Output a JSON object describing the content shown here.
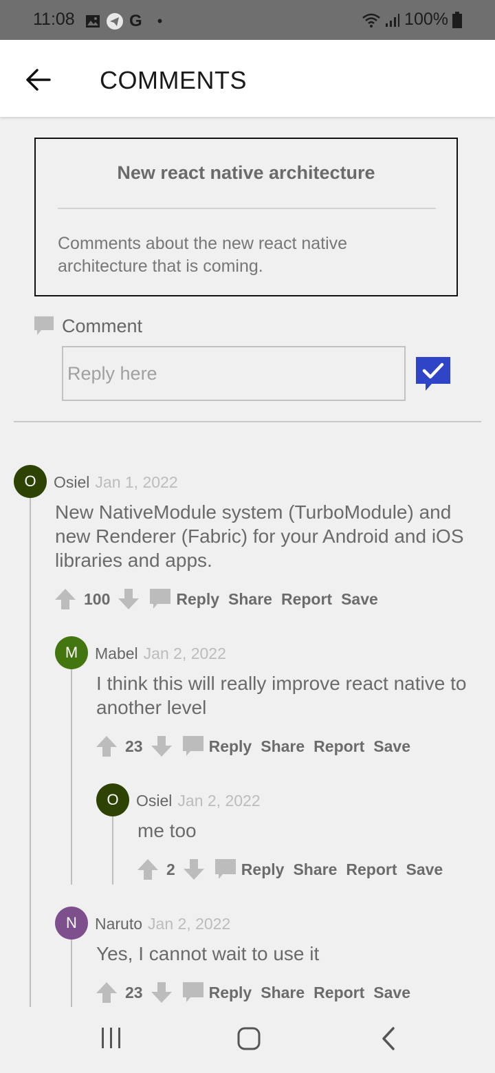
{
  "status_bar": {
    "time": "11:08",
    "battery": "100%",
    "icons": [
      "gallery-icon",
      "telegram-icon",
      "google-icon",
      "dot-icon",
      "wifi-icon",
      "signal-icon",
      "battery-icon"
    ]
  },
  "header": {
    "title": "COMMENTS"
  },
  "post": {
    "title": "New react native architecture",
    "description_line1": "Comments about the new react native",
    "description_line2": "architecture that is coming."
  },
  "composer": {
    "label": "Comment",
    "placeholder": "Reply here",
    "value": ""
  },
  "colors": {
    "accent": "#2f44c7",
    "avatar_dark_green": "#2d4203",
    "avatar_green": "#43760f",
    "avatar_purple": "#7d4f8c",
    "divider": "#c8c8c8"
  },
  "comments": [
    {
      "initial": "O",
      "author": "Osiel",
      "date": "Jan 1, 2022",
      "line1": "New NativeModule system (TurboModule) and",
      "line2": "new Renderer (Fabric) for your Android and iOS",
      "line3": "libraries and apps.",
      "votes": "100",
      "reply": "Reply",
      "share": "Share",
      "report": "Report",
      "save": "Save"
    },
    {
      "initial": "M",
      "author": "Mabel",
      "date": "Jan 2, 2022",
      "line1": "I think this will really improve react native to",
      "line2": "another level",
      "votes": "23",
      "reply": "Reply",
      "share": "Share",
      "report": "Report",
      "save": "Save"
    },
    {
      "initial": "O",
      "author": "Osiel",
      "date": "Jan 2, 2022",
      "line1": "me too",
      "votes": "2",
      "reply": "Reply",
      "share": "Share",
      "report": "Report",
      "save": "Save"
    },
    {
      "initial": "N",
      "author": "Naruto",
      "date": "Jan 2, 2022",
      "line1": "Yes, I cannot wait to use it",
      "votes": "23",
      "reply": "Reply",
      "share": "Share",
      "report": "Report",
      "save": "Save"
    }
  ]
}
